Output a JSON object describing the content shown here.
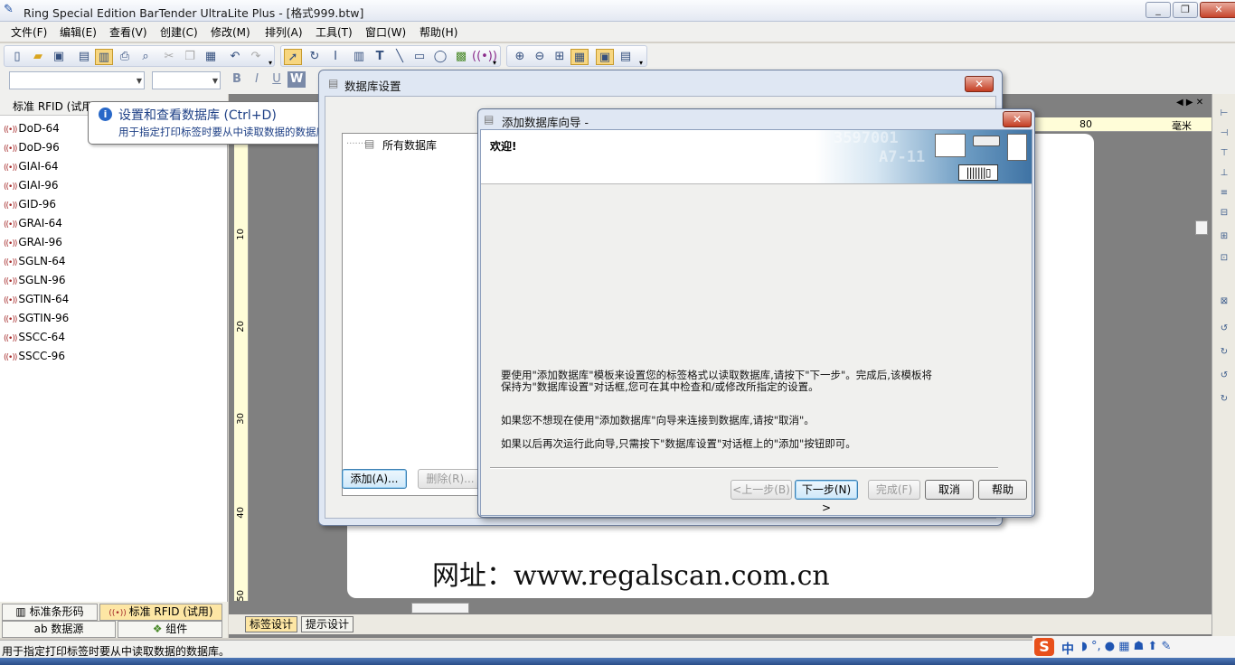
{
  "app": {
    "title": "Ring Special Edition BarTender UltraLite Plus - [格式999.btw]",
    "window_controls": [
      "_",
      "❐",
      "✕"
    ]
  },
  "menu": [
    "文件(F)",
    "编辑(E)",
    "查看(V)",
    "创建(C)",
    "修改(M)",
    "排列(A)",
    "工具(T)",
    "窗口(W)",
    "帮助(H)"
  ],
  "tooltip": {
    "title": "设置和查看数据库 (Ctrl+D)",
    "description": "用于指定打印标签时要从中读取数据的数据库。"
  },
  "left_panel": {
    "header": "标准 RFID (试用)",
    "items": [
      "DoD-64",
      "DoD-96",
      "GIAI-64",
      "GIAI-96",
      "GID-96",
      "GRAI-64",
      "GRAI-96",
      "SGLN-64",
      "SGLN-96",
      "SGTIN-64",
      "SGTIN-96",
      "SSCC-64",
      "SSCC-96"
    ],
    "tabs": {
      "barcode": "标准条形码",
      "rfid": "标准 RFID (试用)",
      "datasource": "数据源",
      "components": "组件"
    }
  },
  "ruler": {
    "vertical_labels": [
      "10",
      "20",
      "30",
      "40",
      "50"
    ],
    "horizontal_label": "80",
    "unit": "毫米"
  },
  "canvas": {
    "url_text": "网址：www.regalscan.com.cn"
  },
  "design_tabs": [
    "标签设计",
    "提示设计"
  ],
  "status_bar": "用于指定打印标签时要从中读取数据的数据库。",
  "ime": {
    "label": "中"
  },
  "db_dialog": {
    "title": "数据库设置",
    "tree_root": "所有数据库",
    "add_button": "添加(A)...",
    "delete_button": "删除(R)..."
  },
  "wizard": {
    "title": "添加数据库向导 -",
    "welcome": "欢迎!",
    "banner_numbers": [
      "3597001",
      "A7-11"
    ],
    "para1_line1": "要使用\"添加数据库\"模板来设置您的标签格式以读取数据库,请按下\"下一步\"。完成后,该模板将",
    "para1_line2": "保持为\"数据库设置\"对话框,您可在其中检查和/或修改所指定的设置。",
    "para2": "如果您不想现在使用\"添加数据库\"向导来连接到数据库,请按\"取消\"。",
    "para3": "如果以后再次运行此向导,只需按下\"数据库设置\"对话框上的\"添加\"按钮即可。",
    "buttons": {
      "back": "<上一步(B)",
      "next": "下一步(N) >",
      "finish": "完成(F)",
      "cancel": "取消",
      "help": "帮助"
    }
  },
  "colors": {
    "accent": "#2868c8",
    "active_tab": "#fde6a4",
    "close_red": "#c43d22",
    "ruler": "#fffdd8"
  }
}
